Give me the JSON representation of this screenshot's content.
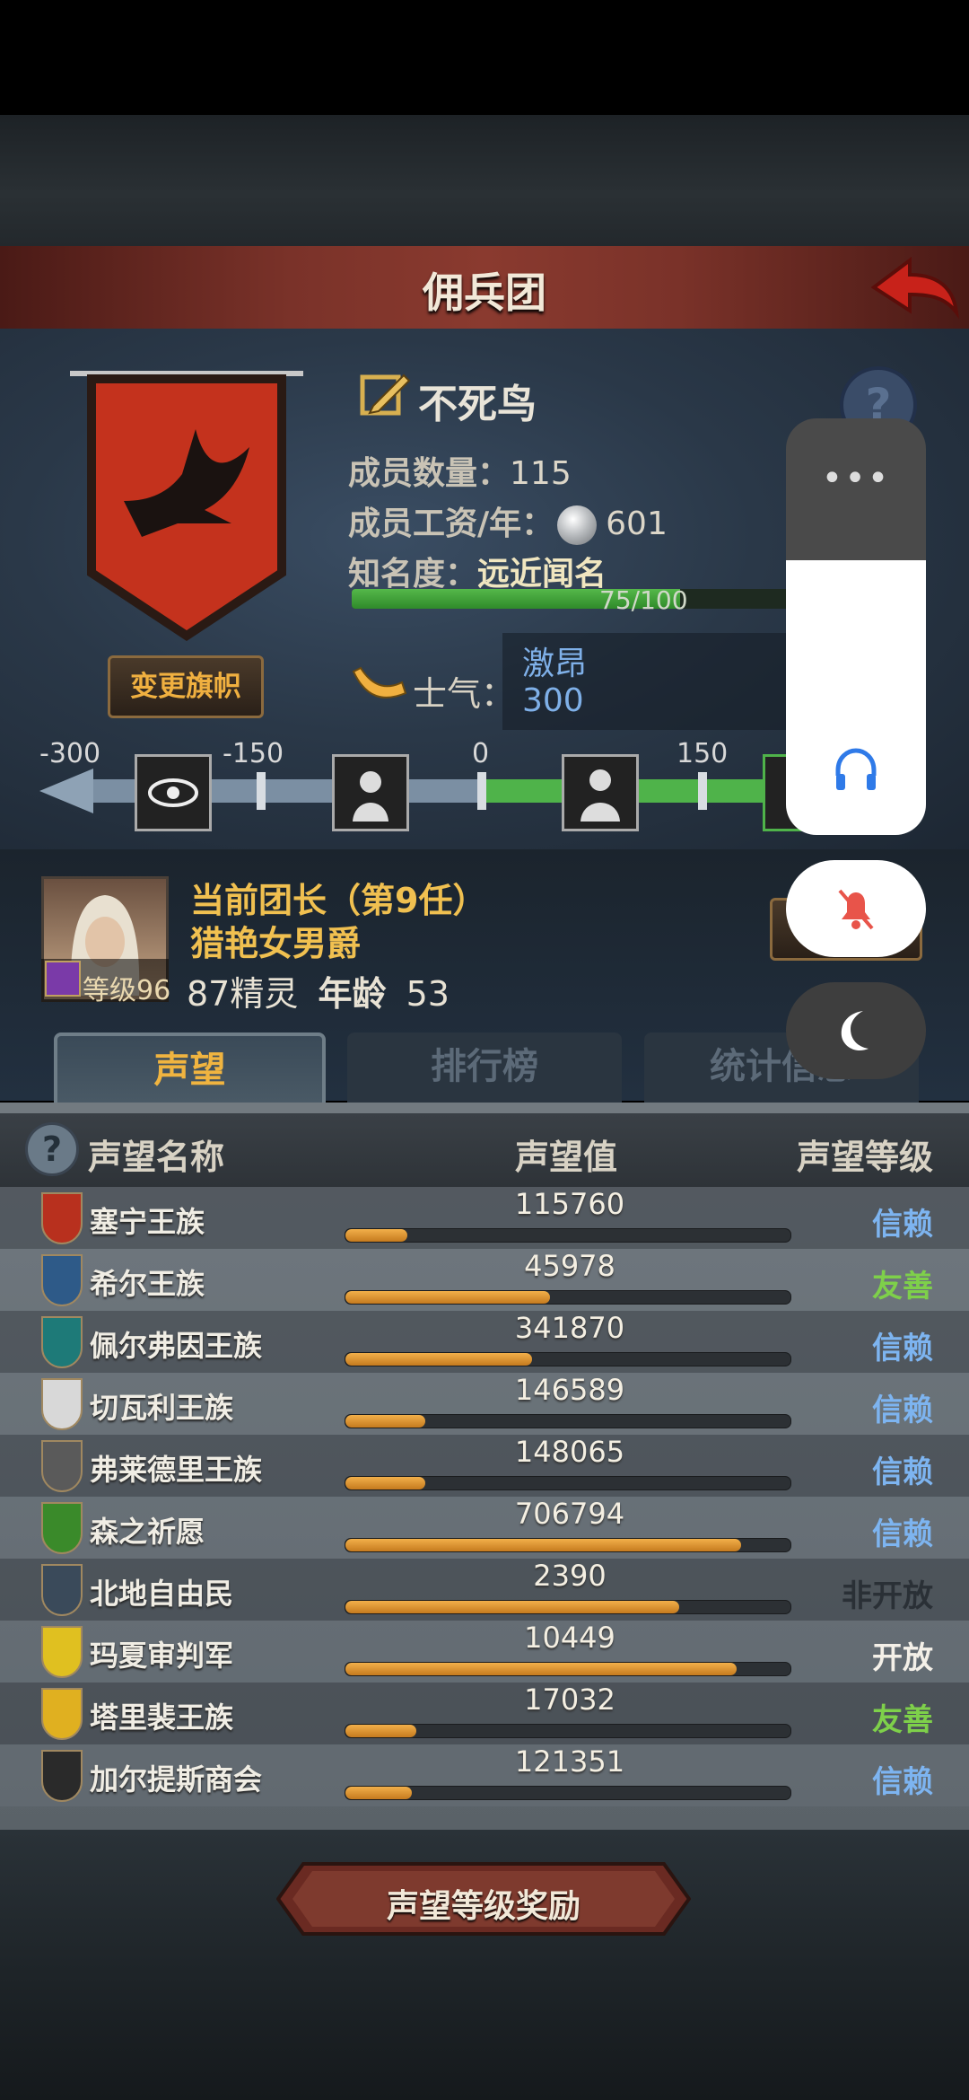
{
  "header": {
    "title": "佣兵团"
  },
  "banner": {
    "change_flag_label": "变更旗帜"
  },
  "mercenary": {
    "name": "不死鸟",
    "members_label": "成员数量：",
    "members_value": "115",
    "wage_label": "成员工资/年：",
    "wage_value": "601",
    "fame_label": "知名度：",
    "fame_value": "远近闻名",
    "fame_progress_text": "75/100",
    "fame_progress": 0.75,
    "morale_label": "士气：",
    "morale_word": "激昂",
    "morale_value": "300"
  },
  "morale_scale": {
    "ticks": [
      "-300",
      "-150",
      "0",
      "150"
    ]
  },
  "leader": {
    "title": "当前团长（第9任）",
    "name": "猎艳女男爵",
    "level": "等级96",
    "info_prefix": "87精灵",
    "age_label": "年龄",
    "age_value": "53"
  },
  "tabs": [
    "声望",
    "排行榜",
    "统计信息"
  ],
  "table": {
    "col_name": "声望名称",
    "col_value": "声望值",
    "col_level": "声望等级",
    "rows": [
      {
        "name": "塞宁王族",
        "value": "115760",
        "fill": 0.14,
        "level": "信赖",
        "level_color": "#7db4f0",
        "crest_color": "#b8301e"
      },
      {
        "name": "希尔王族",
        "value": "45978",
        "fill": 0.46,
        "level": "友善",
        "level_color": "#7ed04a",
        "crest_color": "#2e5a88"
      },
      {
        "name": "佩尔弗因王族",
        "value": "341870",
        "fill": 0.42,
        "level": "信赖",
        "level_color": "#7db4f0",
        "crest_color": "#1e7a78"
      },
      {
        "name": "切瓦利王族",
        "value": "146589",
        "fill": 0.18,
        "level": "信赖",
        "level_color": "#7db4f0",
        "crest_color": "#d8d8d8"
      },
      {
        "name": "弗莱德里王族",
        "value": "148065",
        "fill": 0.18,
        "level": "信赖",
        "level_color": "#7db4f0",
        "crest_color": "#5a5a5a"
      },
      {
        "name": "森之祈愿",
        "value": "706794",
        "fill": 0.89,
        "level": "信赖",
        "level_color": "#7db4f0",
        "crest_color": "#3a8a2a"
      },
      {
        "name": "北地自由民",
        "value": "2390",
        "fill": 0.75,
        "level": "非开放",
        "level_color": "#2a3036",
        "crest_color": "#3a4a5a"
      },
      {
        "name": "玛夏审判军",
        "value": "10449",
        "fill": 0.88,
        "level": "开放",
        "level_color": "#f4f0e8",
        "crest_color": "#e0c020"
      },
      {
        "name": "塔里裴王族",
        "value": "17032",
        "fill": 0.16,
        "level": "友善",
        "level_color": "#7ed04a",
        "crest_color": "#e0b020"
      },
      {
        "name": "加尔提斯商会",
        "value": "121351",
        "fill": 0.15,
        "level": "信赖",
        "level_color": "#7db4f0",
        "crest_color": "#2a2a2a"
      }
    ]
  },
  "footer": {
    "reward_label": "声望等级奖励"
  },
  "overlay": {
    "volume_level": 0.66
  }
}
